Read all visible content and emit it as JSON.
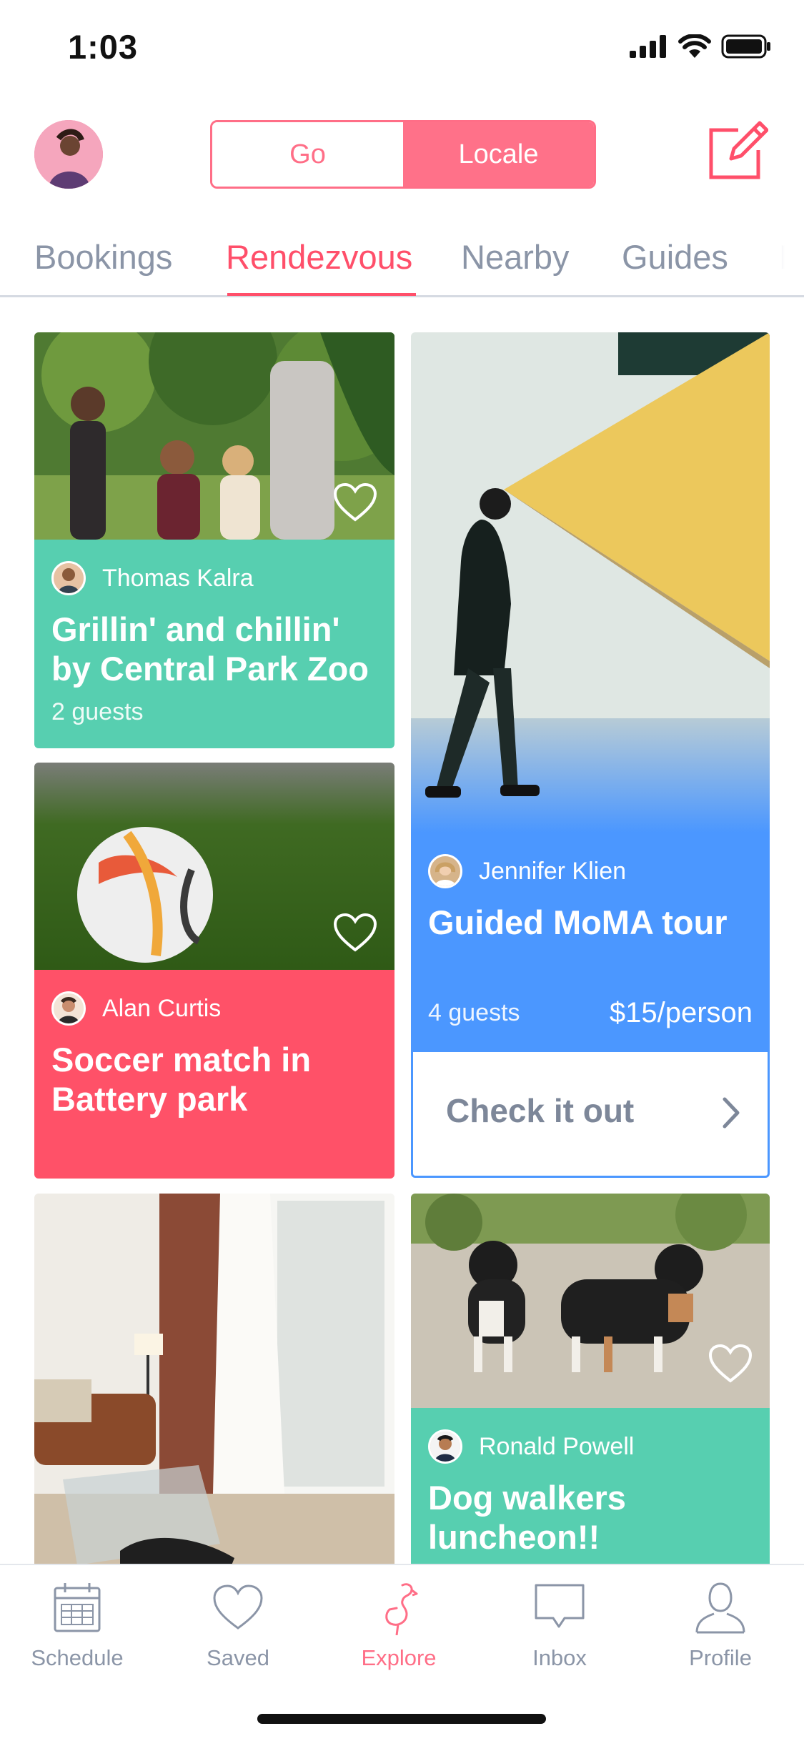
{
  "status_bar": {
    "time": "1:03"
  },
  "header": {
    "segments": [
      {
        "label": "Go",
        "selected": false
      },
      {
        "label": "Locale",
        "selected": true
      }
    ]
  },
  "tabs": [
    {
      "label": "Bookings"
    },
    {
      "label": "Rendezvous",
      "active": true
    },
    {
      "label": "Nearby"
    },
    {
      "label": "Guides"
    },
    {
      "label": "Ba"
    }
  ],
  "cards": [
    {
      "host": "Thomas Kalra",
      "title": "Grillin' and chillin' by Central Park Zoo",
      "guests": "2 guests",
      "color": "#57cfb0"
    },
    {
      "host": "Alan Curtis",
      "title": "Soccer match in Battery park",
      "color": "#ff5168"
    },
    {
      "host": "Jennifer Klien",
      "title": "Guided MoMA tour",
      "guests": "4 guests",
      "price": "$15/person",
      "cta": "Check it out",
      "color": "#4b97ff"
    },
    {
      "host": "Ronald Powell",
      "title": "Dog walkers luncheon!!",
      "color": "#57cfb0"
    }
  ],
  "bottom_nav": [
    {
      "label": "Schedule",
      "icon": "calendar-icon"
    },
    {
      "label": "Saved",
      "icon": "heart-icon"
    },
    {
      "label": "Explore",
      "icon": "flamingo-icon",
      "active": true
    },
    {
      "label": "Inbox",
      "icon": "chat-bubble-icon"
    },
    {
      "label": "Profile",
      "icon": "person-icon"
    }
  ],
  "colors": {
    "accent": "#ff6e87",
    "green": "#57cfb0",
    "red": "#ff5168",
    "blue": "#4b97ff"
  }
}
